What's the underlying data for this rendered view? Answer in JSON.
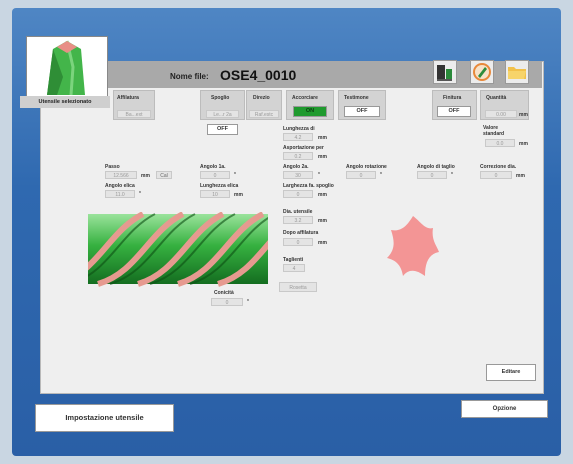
{
  "header": {
    "file_label": "Nome file:",
    "file_name": "OSE4_0010"
  },
  "tool_thumbnail": {
    "caption": "Utensile selezionato"
  },
  "icons": [
    "machine-icon",
    "pencil-icon",
    "folder-icon"
  ],
  "groups": {
    "affilatura": {
      "label": "Affilatura",
      "value": "Ba...ext"
    },
    "spoglio": {
      "label": "Spoglio",
      "value": "Le...r 2a",
      "toggle": "OFF"
    },
    "direzione": {
      "label": "Direzio",
      "value": "Raf.estc"
    },
    "accorciare": {
      "label": "Accorciare",
      "toggle": "ON"
    },
    "testimone": {
      "label": "Testimone",
      "toggle": "OFF"
    },
    "finitura": {
      "label": "Finitura",
      "toggle": "OFF"
    },
    "quantita": {
      "label": "Quantità",
      "value": "0.00",
      "unit": "mm"
    }
  },
  "fields": {
    "lunghezza_di": {
      "label": "Lunghezza di",
      "value": "4.2",
      "unit": "mm"
    },
    "asportazione": {
      "label": "Asportazione per",
      "value": "0.2",
      "unit": "mm"
    },
    "angolo_2a": {
      "label": "Angolo 2a.",
      "value": "30",
      "unit": "°"
    },
    "larghezza": {
      "label": "Larghezza fa. spoglio",
      "value": "0",
      "unit": "mm"
    },
    "angolo_rotazione": {
      "label": "Angolo rotazione",
      "value": "0",
      "unit": "°"
    },
    "angolo_taglio": {
      "label": "Angolo di taglio",
      "value": "0",
      "unit": "°"
    },
    "correzione": {
      "label": "Correzione dia.",
      "value": "0",
      "unit": "mm"
    },
    "valore_standard": {
      "label": "Valore standard",
      "value": "0.0",
      "unit": "mm"
    },
    "passo": {
      "label": "Passo",
      "value": "12.566",
      "unit": "mm",
      "btn": "Cal"
    },
    "angolo_elica": {
      "label": "Angolo elica",
      "value": "11.0",
      "unit": "°"
    },
    "angolo_1a": {
      "label": "Angolo 1a.",
      "value": "0",
      "unit": "°"
    },
    "lunghezza_elica": {
      "label": "Lunghezza elica",
      "value": "10",
      "unit": "mm"
    },
    "dia_utensile": {
      "label": "Dia. utensile",
      "value": "3.2",
      "unit": "mm"
    },
    "dopo_affilatura": {
      "label": "Dopo affilatura",
      "value": "0",
      "unit": "mm"
    },
    "taglienti": {
      "label": "Taglienti",
      "value": "4"
    },
    "conicita": {
      "label": "Conicità",
      "value": "0",
      "unit": "°"
    },
    "modo": {
      "value": "Rosetta"
    }
  },
  "buttons": {
    "editare": "Editare",
    "impostazione": "Impostazione utensile",
    "opzione": "Opzione"
  }
}
